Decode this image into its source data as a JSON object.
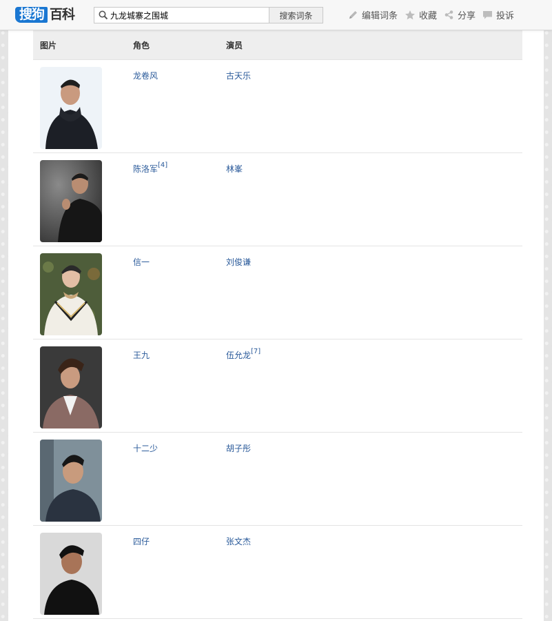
{
  "header": {
    "logo_brand": "搜狗",
    "logo_text": "百科",
    "search_value": "九龙城寨之围城",
    "search_button": "搜索词条",
    "actions": [
      {
        "label": "编辑词条",
        "icon": "pencil-icon"
      },
      {
        "label": "收藏",
        "icon": "star-icon"
      },
      {
        "label": "分享",
        "icon": "share-icon"
      },
      {
        "label": "投诉",
        "icon": "comment-icon"
      }
    ]
  },
  "table": {
    "columns": [
      "图片",
      "角色",
      "演员"
    ],
    "rows": [
      {
        "role": "龙卷风",
        "role_ref": "",
        "actor": "古天乐",
        "actor_ref": ""
      },
      {
        "role": "陈洛军",
        "role_ref": "[4]",
        "actor": "林峯",
        "actor_ref": ""
      },
      {
        "role": "信一",
        "role_ref": "",
        "actor": "刘俊谦",
        "actor_ref": ""
      },
      {
        "role": "王九",
        "role_ref": "",
        "actor": "伍允龙",
        "actor_ref": "[7]"
      },
      {
        "role": "十二少",
        "role_ref": "",
        "actor": "胡子彤",
        "actor_ref": ""
      },
      {
        "role": "四仔",
        "role_ref": "",
        "actor": "张文杰",
        "actor_ref": ""
      }
    ]
  },
  "colors": {
    "brand_blue": "#1a77d2",
    "link_blue": "#2a5a9a",
    "header_bg": "#eeeeee"
  }
}
